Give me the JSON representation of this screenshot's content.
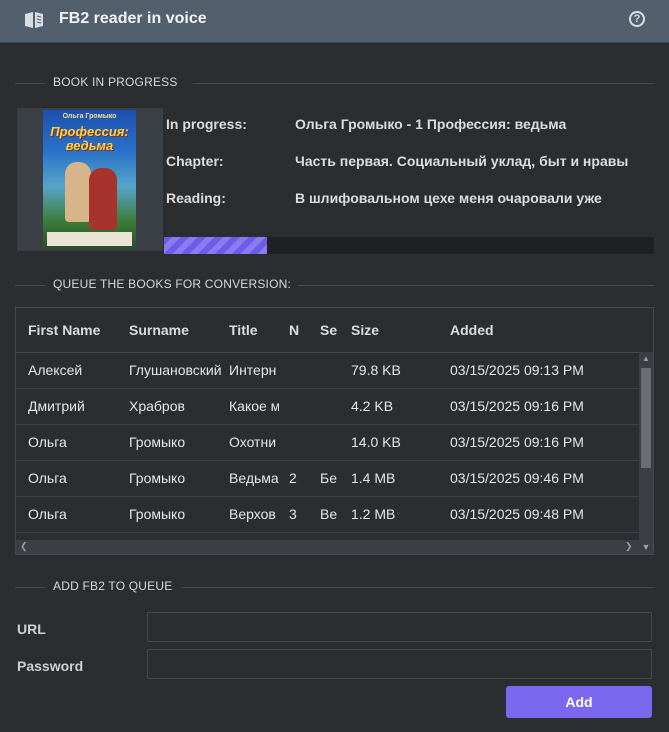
{
  "window": {
    "title": "FB2 reader in voice",
    "help_icon": "help-circle-icon",
    "app_icon": "open-book-icon"
  },
  "progress_section": {
    "heading": "BOOK IN PROGRESS",
    "cover": {
      "author": "Ольга Громыко",
      "title": "Профессия: ведьма"
    },
    "in_progress_label": "In progress:",
    "in_progress_value": "Ольга Громыко - 1 Профессия: ведьма",
    "chapter_label": "Chapter:",
    "chapter_value": "Часть первая. Социальный уклад, быт и нравы",
    "reading_label": "Reading:",
    "reading_value": "В шлифовальном цехе меня очаровали уже",
    "progress_fraction": 0.21,
    "progress_color": "#6c5ce7"
  },
  "queue_section": {
    "heading": "QUEUE THE BOOKS FOR CONVERSION:",
    "columns": [
      "First Name",
      "Surname",
      "Title",
      "N",
      "Se",
      "Size",
      "Added"
    ],
    "rows": [
      [
        "Алексей",
        "Глушановский",
        "Интерн",
        "",
        "",
        "79.8 KB",
        "03/15/2025 09:13 PM"
      ],
      [
        "Дмитрий",
        "Храбров",
        "Какое м",
        "",
        "",
        "4.2 KB",
        "03/15/2025 09:16 PM"
      ],
      [
        "Ольга",
        "Громыко",
        "Охотни",
        "",
        "",
        "14.0 KB",
        "03/15/2025 09:16 PM"
      ],
      [
        "Ольга",
        "Громыко",
        "Ведьма",
        "2",
        "Бе",
        "1.4 MB",
        "03/15/2025 09:46 PM"
      ],
      [
        "Ольга",
        "Громыко",
        "Верхов",
        "3",
        "Ве",
        "1.2 MB",
        "03/15/2025 09:48 PM"
      ]
    ]
  },
  "add_section": {
    "heading": "ADD FB2 TO QUEUE",
    "url_label": "URL",
    "url_value": "",
    "password_label": "Password",
    "password_value": "",
    "add_button": "Add",
    "accent": "#7b68ee"
  }
}
